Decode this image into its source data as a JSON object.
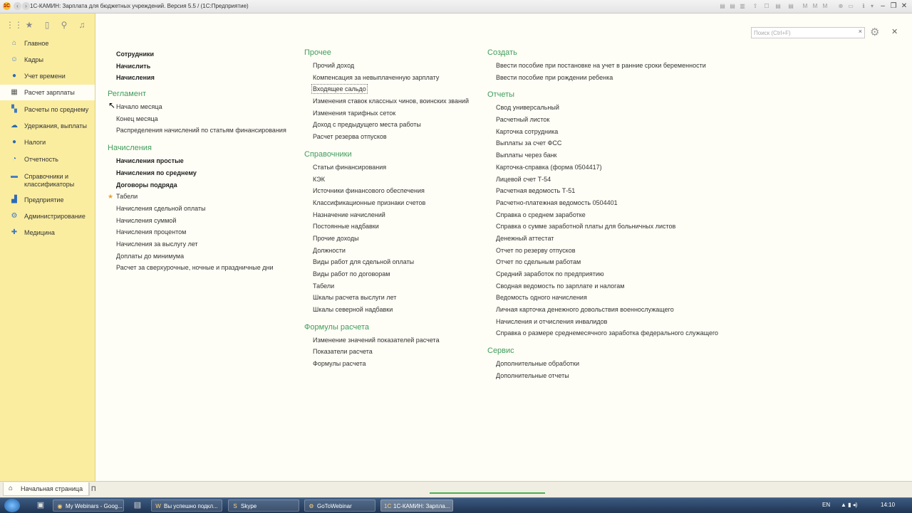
{
  "titlebar": {
    "logo": "1С",
    "title": "1С-КАМИН: Зарплата для бюджетных учреждений. Версия 5.5 /   (1С:Предприятие)"
  },
  "sidebar": {
    "items": [
      {
        "label": "Главное",
        "icon": "home-icon",
        "color": "#5a7fb0",
        "glyph": "⌂"
      },
      {
        "label": "Кадры",
        "icon": "people-icon",
        "color": "#4a86c8",
        "glyph": "☺"
      },
      {
        "label": "Учет времени",
        "icon": "clock-icon",
        "color": "#2e6bb5",
        "glyph": "●"
      },
      {
        "label": "Расчет зарплаты",
        "icon": "calculator-icon",
        "color": "#555555",
        "glyph": "▦"
      },
      {
        "label": "Расчеты по среднему",
        "icon": "chart-icon",
        "color": "#3d78c0",
        "glyph": "▚"
      },
      {
        "label": "Удержания, выплаты",
        "icon": "money-icon",
        "color": "#2a69b0",
        "glyph": "☁"
      },
      {
        "label": "Налоги",
        "icon": "tax-icon",
        "color": "#2b6cb0",
        "glyph": "●"
      },
      {
        "label": "Отчетность",
        "icon": "report-icon",
        "color": "#2e6bb5",
        "glyph": "◔"
      },
      {
        "label": "Справочники и классификаторы",
        "icon": "books-icon",
        "color": "#4a7fc0",
        "glyph": "▬"
      },
      {
        "label": "Предприятие",
        "icon": "enterprise-icon",
        "color": "#2e6bb5",
        "glyph": "▟"
      },
      {
        "label": "Администрирование",
        "icon": "admin-icon",
        "color": "#3d78c0",
        "glyph": "⚙"
      },
      {
        "label": "Медицина",
        "icon": "medicine-icon",
        "color": "#3d78c0",
        "glyph": "✚"
      }
    ]
  },
  "search": {
    "placeholder": "Поиск (Ctrl+F)",
    "clear": "×"
  },
  "col1": {
    "top": [
      "Сотрудники",
      "Начислить",
      "Начисления"
    ],
    "reglament": {
      "title": "Регламент",
      "items": [
        "Начало месяца",
        "Конец месяца",
        "Распределения начислений по статьям финансирования"
      ]
    },
    "accruals": {
      "title": "Начисления",
      "bold": [
        "Начисления простые",
        "Начисления по среднему",
        "Договоры подряда"
      ],
      "items": [
        "Табели",
        "Начисления сдельной оплаты",
        "Начисления суммой",
        "Начисления процентом",
        "Начисления за выслугу лет",
        "Доплаты до минимума",
        "Расчет за сверхурочные, ночные и праздничные дни"
      ]
    }
  },
  "col2": {
    "other": {
      "title": "Прочее",
      "items": [
        "Прочий доход",
        "Компенсация за невыплаченную зарплату",
        "Входящее сальдо",
        "Изменения ставок классных чинов, воинских званий",
        "Изменения тарифных сеток",
        "Доход с предыдущего места работы",
        "Расчет резерва отпусков"
      ]
    },
    "refs": {
      "title": "Справочники",
      "items": [
        "Статьи финансирования",
        "КЭК",
        "Источники финансового обеспечения",
        "Классификационные признаки счетов",
        "Назначение начислений",
        "Постоянные надбавки",
        "Прочие доходы",
        "Должности",
        "Виды работ для сдельной оплаты",
        "Виды работ по договорам",
        "Табели",
        "Шкалы расчета выслуги лет",
        "Шкалы северной надбавки"
      ]
    },
    "formulas": {
      "title": "Формулы расчета",
      "items": [
        "Изменение значений показателей расчета",
        "Показатели расчета",
        "Формулы расчета"
      ]
    }
  },
  "col3": {
    "create": {
      "title": "Создать",
      "items": [
        "Ввести пособие при постановке на учет в ранние сроки беременности",
        "Ввести пособие при рождении ребенка"
      ]
    },
    "reports": {
      "title": "Отчеты",
      "items": [
        "Свод универсальный",
        "Расчетный листок",
        "Карточка сотрудника",
        "Выплаты за счет ФСС",
        "Выплаты через банк",
        "Карточка-справка (форма 0504417)",
        "Лицевой счет Т-54",
        "Расчетная ведомость Т-51",
        "Расчетно-платежная ведомость 0504401",
        "Справка о среднем заработке",
        "Справка о сумме заработной платы для больничных листов",
        "Денежный аттестат",
        "Отчет по резерву отпусков",
        "Отчет по сдельным работам",
        "Средний заработок по предприятию",
        "Сводная ведомость по зарплате и налогам",
        "Ведомость одного начисления",
        "Личная карточка денежного довольствия военнослужащего",
        "Начисления и отчисления инвалидов",
        "Справка о размере среднемесячного заработка федерального служащего"
      ]
    },
    "service": {
      "title": "Сервис",
      "items": [
        "Дополнительные обработки",
        "Дополнительные отчеты"
      ]
    }
  },
  "bottom": {
    "start_tab": "Начальная страница",
    "next_tab": "П"
  },
  "taskbar": {
    "tasks": [
      "My Webinars - Goog...",
      "Вы успешно подкл...",
      "Skype",
      "GoToWebinar",
      "1С-КАМИН: Зарпла..."
    ],
    "lang": "EN",
    "time": "14:10"
  }
}
